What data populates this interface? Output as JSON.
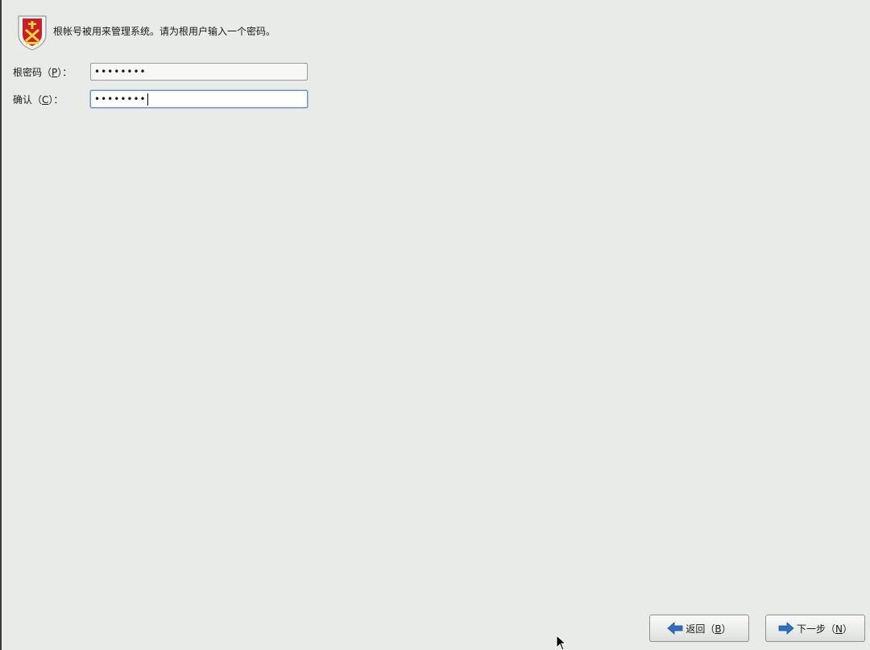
{
  "header": {
    "icon": "shield-icon",
    "message": "根帐号被用来管理系统。请为根用户输入一个密码。"
  },
  "form": {
    "password": {
      "label_prefix": "根密码（",
      "mnemonic": "P",
      "label_suffix": "）：",
      "value": "••••••••"
    },
    "confirm": {
      "label_prefix": "确认（",
      "mnemonic": "C",
      "label_suffix": "）：",
      "value": "••••••••"
    }
  },
  "buttons": {
    "back": {
      "icon": "arrow-left-icon",
      "label_prefix": "返回（",
      "mnemonic": "B",
      "label_suffix": "）"
    },
    "next": {
      "icon": "arrow-right-icon",
      "label_prefix": "下一步（",
      "mnemonic": "N",
      "label_suffix": "）"
    }
  },
  "colors": {
    "background": "#e8ebe8",
    "shield_red": "#c8202a",
    "arrow_blue": "#2f6fc0",
    "focus_border": "#6f93c7"
  }
}
